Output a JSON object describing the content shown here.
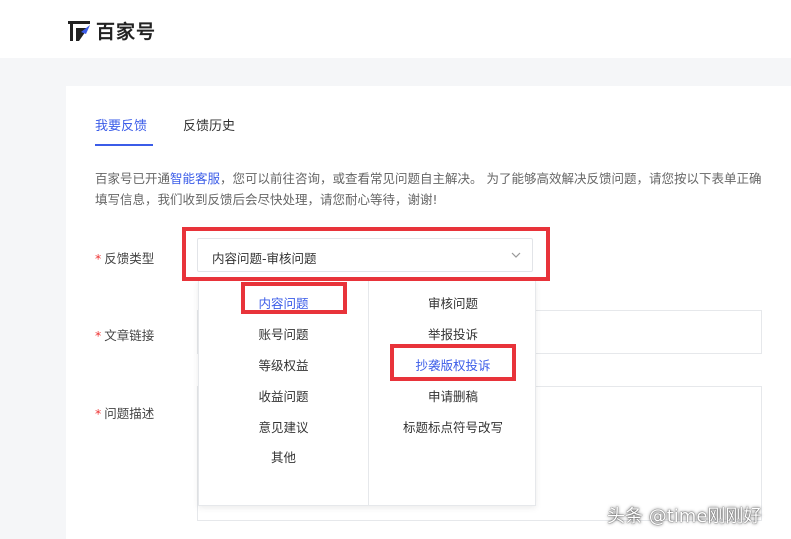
{
  "brand": {
    "name": "百家号",
    "icon": "baijiahao-logo-icon"
  },
  "tabs": [
    {
      "label": "我要反馈",
      "active": true
    },
    {
      "label": "反馈历史",
      "active": false
    }
  ],
  "intro": {
    "part1": "百家号已开通",
    "link": "智能客服",
    "part2": "，您可以前往咨询，或查看常见问题自主解决。 为了能够高效解决反馈问题，请您按以下表单正确填写信息，我们收到反馈后会尽快处理，请您耐心等待，谢谢!"
  },
  "form": {
    "required_mark": "*",
    "feedback_type": {
      "label": "反馈类型",
      "value": "内容问题-审核问题"
    },
    "article_link": {
      "label": "文章链接"
    },
    "problem_desc": {
      "label": "问题描述"
    }
  },
  "dropdown": {
    "categories": [
      "内容问题",
      "账号问题",
      "等级权益",
      "收益问题",
      "意见建议",
      "其他"
    ],
    "subcategories": [
      "审核问题",
      "举报投诉",
      "抄袭版权投诉",
      "申请删稿",
      "标题标点符号改写"
    ],
    "selected_category": "内容问题",
    "highlighted_subcategory": "抄袭版权投诉"
  },
  "watermark": "头条 @time刚刚好",
  "colors": {
    "accent": "#3b5ce8",
    "highlight": "#e8333a",
    "required": "#ee3333"
  }
}
